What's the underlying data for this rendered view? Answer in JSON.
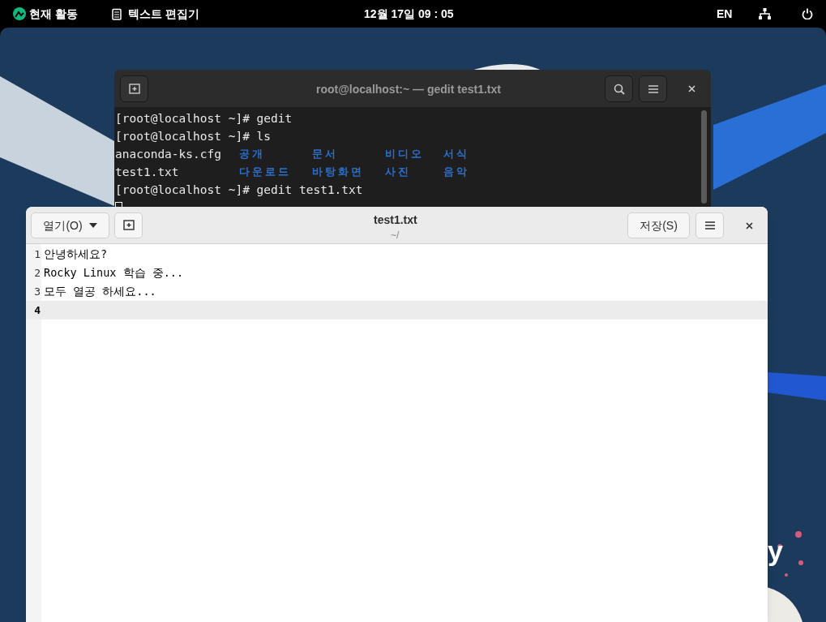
{
  "top_bar": {
    "activities": "현재 활동",
    "app_menu": "텍스트 편집기",
    "clock": "12월 17일 09 : 05",
    "input_source": "EN"
  },
  "wallpaper": {
    "logo_fragment": "y"
  },
  "terminal": {
    "title": "root@localhost:~ — gedit test1.txt",
    "lines": [
      {
        "kind": "text",
        "text": "[root@localhost ~]# gedit"
      },
      {
        "kind": "text",
        "text": "[root@localhost ~]# ls"
      },
      {
        "kind": "listing",
        "items": [
          {
            "text": "anaconda-ks.cfg",
            "kind": "file"
          },
          {
            "text": "공개",
            "kind": "dir"
          },
          {
            "text": "문서",
            "kind": "dir"
          },
          {
            "text": "비디오",
            "kind": "dir"
          },
          {
            "text": "서식",
            "kind": "dir"
          }
        ]
      },
      {
        "kind": "listing",
        "items": [
          {
            "text": "test1.txt",
            "kind": "file"
          },
          {
            "text": "다운로드",
            "kind": "dir"
          },
          {
            "text": "바탕화면",
            "kind": "dir"
          },
          {
            "text": "사진",
            "kind": "dir"
          },
          {
            "text": "음악",
            "kind": "dir"
          }
        ]
      },
      {
        "kind": "text",
        "text": "[root@localhost ~]# gedit test1.txt"
      },
      {
        "kind": "cursor"
      }
    ]
  },
  "gedit": {
    "open_button": "열기(O)",
    "title": "test1.txt",
    "subtitle": "~/",
    "save_button": "저장(S)",
    "lines": [
      {
        "number": "1",
        "text": "안녕하세요?",
        "selected": false
      },
      {
        "number": "2",
        "text": "Rocky Linux 학습 중...",
        "selected": false
      },
      {
        "number": "3",
        "text": "모두 열공 하세요...",
        "selected": false
      },
      {
        "number": "4",
        "selected": true
      }
    ]
  }
}
